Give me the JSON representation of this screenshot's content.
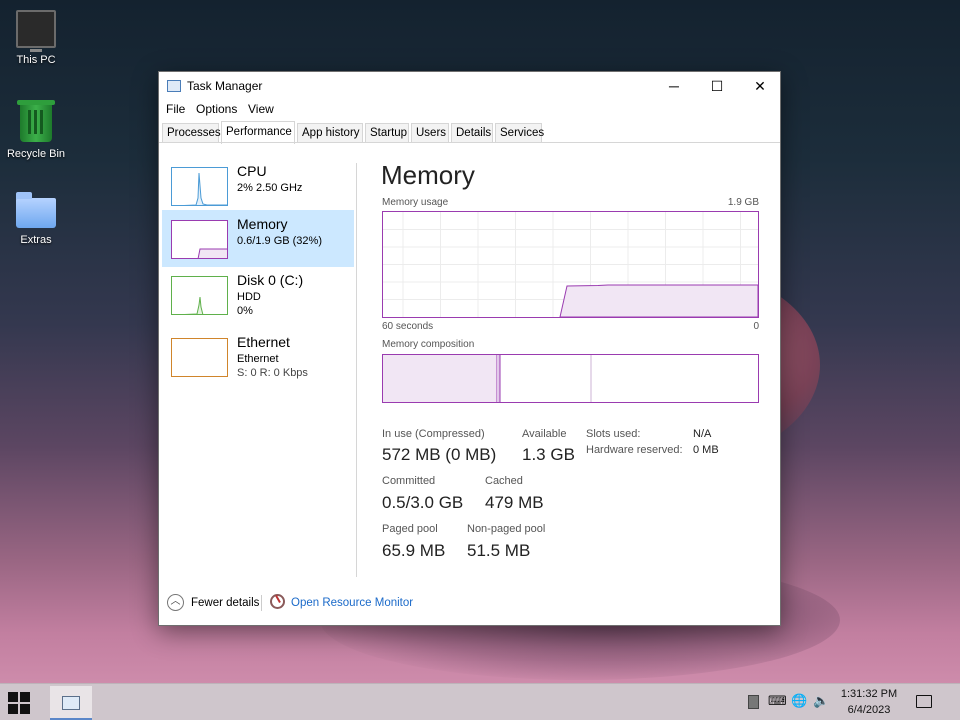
{
  "desktop": {
    "icons": [
      {
        "label": "This PC"
      },
      {
        "label": "Recycle Bin"
      },
      {
        "label": "Extras"
      }
    ]
  },
  "window": {
    "title": "Task Manager",
    "controls": {
      "minimize": "─",
      "maximize": "☐",
      "close": "✕"
    },
    "menu": [
      "File",
      "Options",
      "View"
    ],
    "tabs": [
      "Processes",
      "Performance",
      "App history",
      "Startup",
      "Users",
      "Details",
      "Services"
    ],
    "active_tab": "Performance"
  },
  "sidebar": {
    "items": [
      {
        "name": "CPU",
        "line1": "2% 2.50 GHz",
        "line2": "",
        "color": "#4b9bd6"
      },
      {
        "name": "Memory",
        "line1": "0.6/1.9 GB (32%)",
        "line2": "",
        "color": "#9a3bb0",
        "selected": true
      },
      {
        "name": "Disk 0 (C:)",
        "line1": "HDD",
        "line2": "0%",
        "color": "#5fb04b"
      },
      {
        "name": "Ethernet",
        "line1": "Ethernet",
        "line2": "S: 0 R: 0 Kbps",
        "color": "#d0852b"
      }
    ]
  },
  "memory": {
    "title": "Memory",
    "usage_label": "Memory usage",
    "usage_max": "1.9 GB",
    "time_left": "60 seconds",
    "time_right": "0",
    "composition_label": "Memory composition",
    "accent": "#9a3bb0",
    "stats": {
      "in_use_label": "In use (Compressed)",
      "in_use_value": "572 MB (0 MB)",
      "available_label": "Available",
      "available_value": "1.3 GB",
      "committed_label": "Committed",
      "committed_value": "0.5/3.0 GB",
      "cached_label": "Cached",
      "cached_value": "479 MB",
      "paged_label": "Paged pool",
      "paged_value": "65.9 MB",
      "nonpaged_label": "Non-paged pool",
      "nonpaged_value": "51.5 MB",
      "slots_label": "Slots used:",
      "slots_value": "N/A",
      "hw_label": "Hardware reserved:",
      "hw_value": "0 MB"
    }
  },
  "footer": {
    "fewer_details": "Fewer details",
    "resource_monitor": "Open Resource Monitor"
  },
  "taskbar": {
    "time": "1:31:32 PM",
    "date": "6/4/2023"
  }
}
